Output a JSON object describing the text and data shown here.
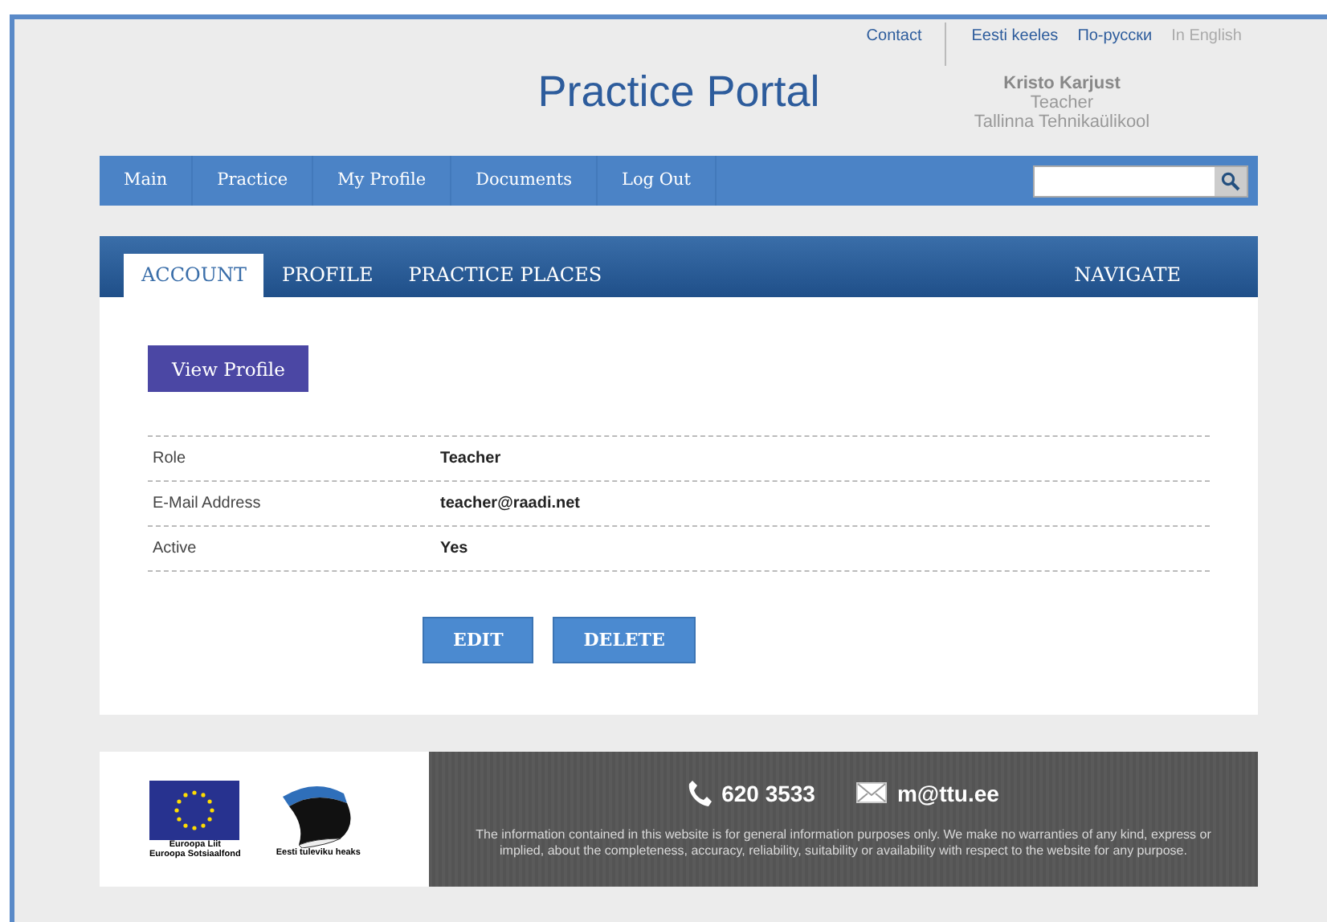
{
  "top_links": [
    {
      "label": "Contact",
      "selected": false
    },
    {
      "label": "Eesti keeles",
      "selected": false
    },
    {
      "label": "По-русски",
      "selected": false
    },
    {
      "label": "In English",
      "selected": true
    }
  ],
  "site_title": "Practice Portal",
  "user": {
    "name": "Kristo Karjust",
    "role": "Teacher",
    "school": "Tallinna Tehnikaülikool"
  },
  "nav": [
    "Main",
    "Practice",
    "My Profile",
    "Documents",
    "Log Out"
  ],
  "tabs": [
    {
      "label": "ACCOUNT",
      "selected": true
    },
    {
      "label": "PROFILE",
      "selected": false
    },
    {
      "label": "PRACTICE PLACES",
      "selected": false
    }
  ],
  "navigate": "NAVIGATE",
  "view_profile": "View Profile",
  "fields": [
    {
      "label": "Role",
      "value": "Teacher"
    },
    {
      "label": "E-Mail Address",
      "value": "teacher@raadi.net"
    },
    {
      "label": "Active",
      "value": "Yes"
    }
  ],
  "actions": [
    "EDIT",
    "DELETE"
  ],
  "footer": {
    "eu_caption": [
      "Euroopa Liit",
      "Euroopa Sotsiaalfond"
    ],
    "ee_caption": "Eesti tuleviku heaks",
    "phone": "620 3533",
    "email": "m@ttu.ee",
    "disclaimer": "The information contained in this website is for general information purposes only. We make no warranties of any kind, express or implied, about the completeness, accuracy, reliability, suitability or availability with respect to the website for any purpose."
  }
}
